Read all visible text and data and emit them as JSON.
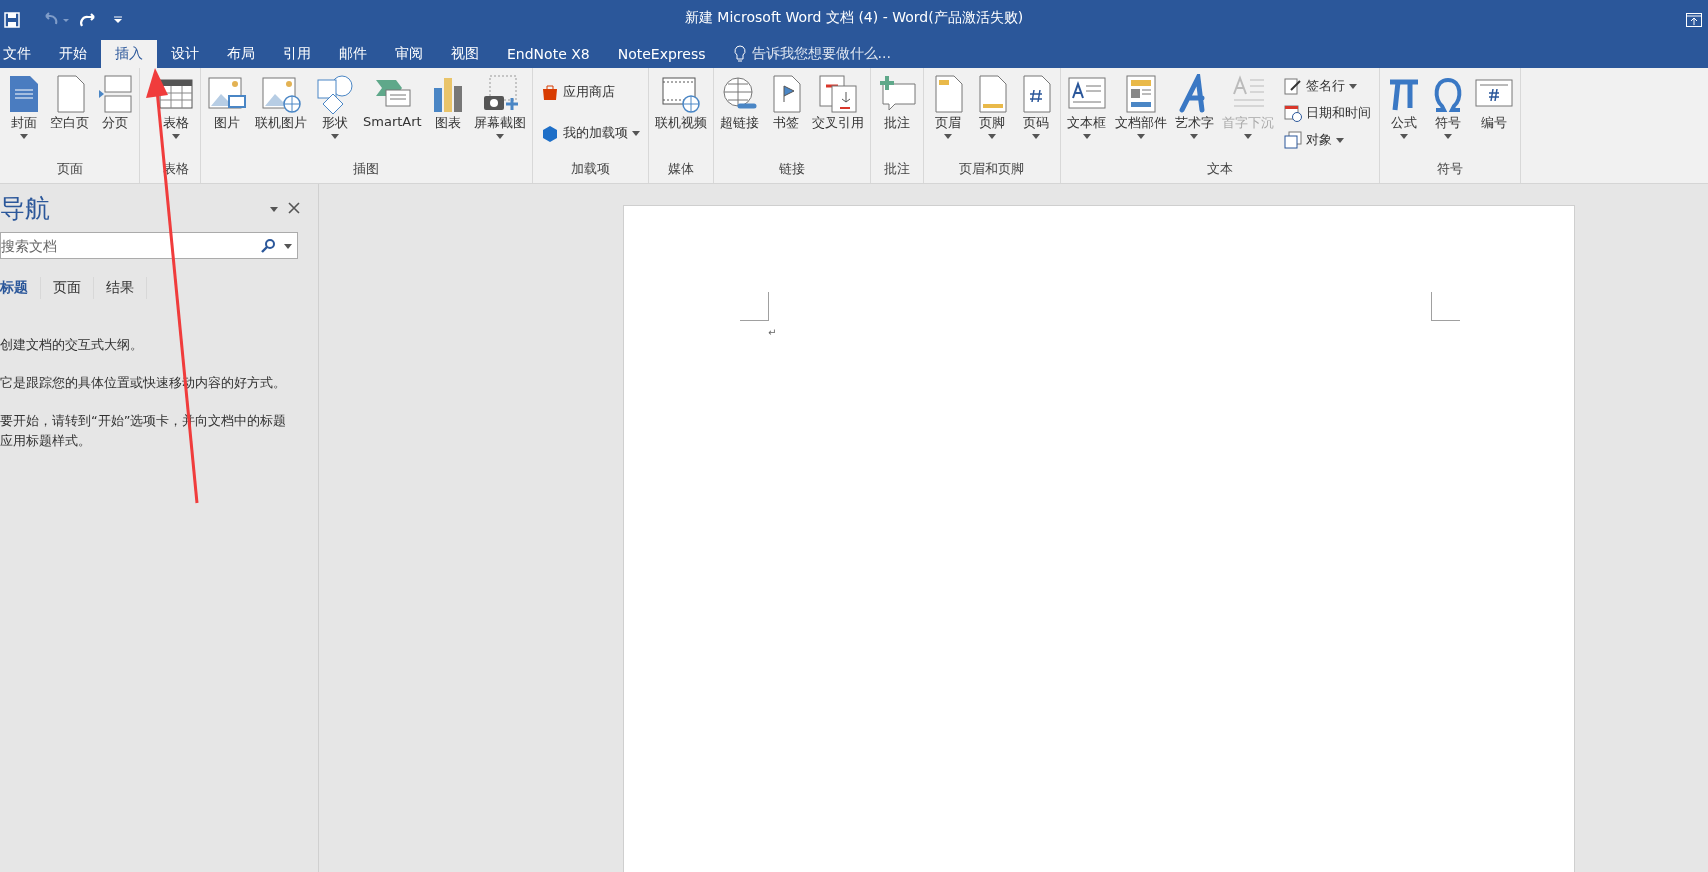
{
  "window": {
    "title": "新建 Microsoft Word 文档 (4) - Word(产品激活失败)",
    "undo_disabled": true
  },
  "tabs": [
    {
      "label": "文件",
      "selected": false
    },
    {
      "label": "开始",
      "selected": false
    },
    {
      "label": "插入",
      "selected": true
    },
    {
      "label": "设计",
      "selected": false
    },
    {
      "label": "布局",
      "selected": false
    },
    {
      "label": "引用",
      "selected": false
    },
    {
      "label": "邮件",
      "selected": false
    },
    {
      "label": "审阅",
      "selected": false
    },
    {
      "label": "视图",
      "selected": false
    },
    {
      "label": "EndNote X8",
      "selected": false
    },
    {
      "label": "NoteExpress",
      "selected": false
    }
  ],
  "tell_me": {
    "placeholder": "告诉我您想要做什么..."
  },
  "ribbon": {
    "groups": [
      {
        "label": "页面",
        "items": [
          {
            "kind": "large",
            "label": "封面",
            "dropdown": true,
            "disabled": false
          },
          {
            "kind": "large",
            "label": "空白页",
            "dropdown": false,
            "disabled": false
          },
          {
            "kind": "large",
            "label": "分页",
            "dropdown": false,
            "disabled": false
          }
        ]
      },
      {
        "label": "表格",
        "items": [
          {
            "kind": "large",
            "label": "表格",
            "dropdown": true,
            "disabled": false
          }
        ]
      },
      {
        "label": "插图",
        "items": [
          {
            "kind": "large",
            "label": "图片",
            "dropdown": false,
            "disabled": false
          },
          {
            "kind": "large",
            "label": "联机图片",
            "dropdown": false,
            "disabled": false
          },
          {
            "kind": "large",
            "label": "形状",
            "dropdown": true,
            "disabled": false
          },
          {
            "kind": "large",
            "label": "SmartArt",
            "dropdown": false,
            "disabled": false
          },
          {
            "kind": "large",
            "label": "图表",
            "dropdown": false,
            "disabled": false
          },
          {
            "kind": "large",
            "label": "屏幕截图",
            "dropdown": true,
            "disabled": false
          }
        ]
      },
      {
        "label": "加载项",
        "items": [
          {
            "kind": "small",
            "label": "应用商店",
            "dropdown": false,
            "disabled": false
          },
          {
            "kind": "small",
            "label": "我的加载项",
            "dropdown": true,
            "disabled": false
          }
        ]
      },
      {
        "label": "媒体",
        "items": [
          {
            "kind": "large",
            "label": "联机视频",
            "dropdown": false,
            "disabled": false
          }
        ]
      },
      {
        "label": "链接",
        "items": [
          {
            "kind": "large",
            "label": "超链接",
            "dropdown": false,
            "disabled": false
          },
          {
            "kind": "large",
            "label": "书签",
            "dropdown": false,
            "disabled": false
          },
          {
            "kind": "large",
            "label": "交叉引用",
            "dropdown": false,
            "disabled": false
          }
        ]
      },
      {
        "label": "批注",
        "items": [
          {
            "kind": "large",
            "label": "批注",
            "dropdown": false,
            "disabled": false
          }
        ]
      },
      {
        "label": "页眉和页脚",
        "items": [
          {
            "kind": "large",
            "label": "页眉",
            "dropdown": true,
            "disabled": false
          },
          {
            "kind": "large",
            "label": "页脚",
            "dropdown": true,
            "disabled": false
          },
          {
            "kind": "large",
            "label": "页码",
            "dropdown": true,
            "disabled": false
          }
        ]
      },
      {
        "label": "文本",
        "items": [
          {
            "kind": "large",
            "label": "文本框",
            "dropdown": true,
            "disabled": false
          },
          {
            "kind": "large",
            "label": "文档部件",
            "dropdown": true,
            "disabled": false
          },
          {
            "kind": "large",
            "label": "艺术字",
            "dropdown": true,
            "disabled": false
          },
          {
            "kind": "large",
            "label": "首字下沉",
            "dropdown": true,
            "disabled": true
          },
          {
            "kind": "small",
            "label": "签名行",
            "dropdown": true,
            "disabled": false
          },
          {
            "kind": "small",
            "label": "日期和时间",
            "dropdown": false,
            "disabled": false
          },
          {
            "kind": "small",
            "label": "对象",
            "dropdown": true,
            "disabled": false
          }
        ]
      },
      {
        "label": "符号",
        "items": [
          {
            "kind": "large",
            "label": "公式",
            "dropdown": true,
            "disabled": false
          },
          {
            "kind": "large",
            "label": "符号",
            "dropdown": true,
            "disabled": false
          },
          {
            "kind": "large",
            "label": "编号",
            "dropdown": false,
            "disabled": false
          }
        ]
      }
    ]
  },
  "navigation": {
    "title": "导航",
    "search": {
      "placeholder": "搜索文档"
    },
    "tabs": [
      {
        "label": "标题",
        "selected": true
      },
      {
        "label": "页面",
        "selected": false
      },
      {
        "label": "结果",
        "selected": false
      }
    ],
    "paragraphs": [
      "创建文档的交互式大纲。",
      "它是跟踪您的具体位置或快速移动内容的好方式。",
      "要开始，请转到“开始”选项卡，并向文档中的标题应用标题样式。"
    ]
  },
  "document": {
    "paragraph_mark": "↵"
  }
}
